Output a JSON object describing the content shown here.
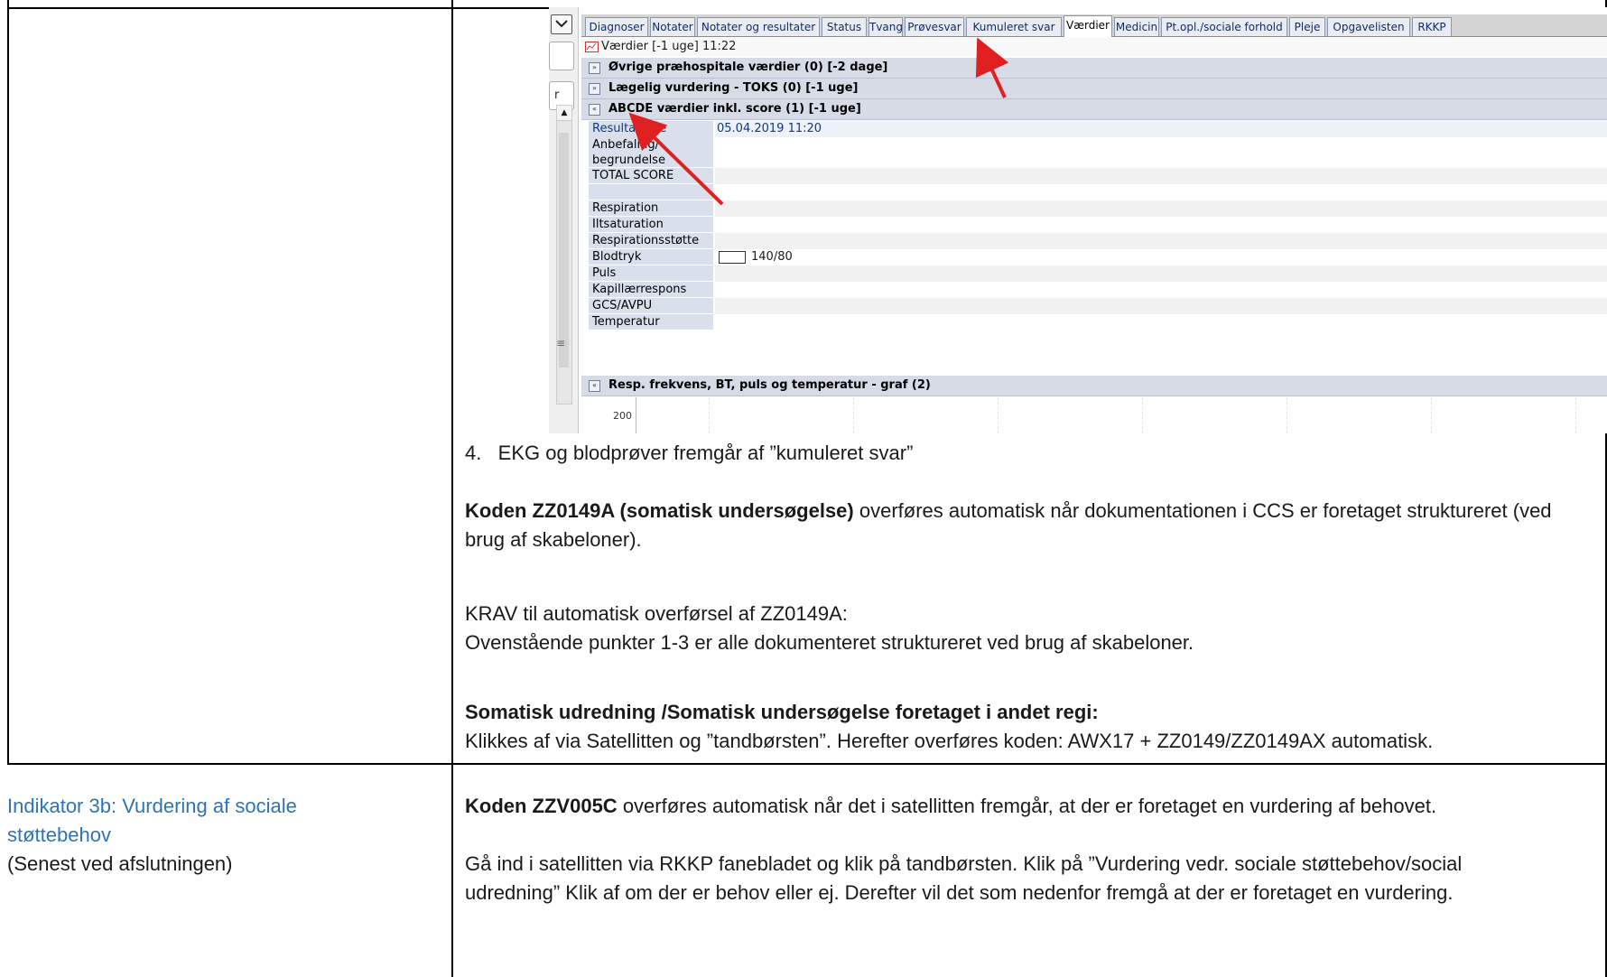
{
  "screenshot": {
    "tabs": [
      "Diagnoser",
      "Notater",
      "Notater og resultater",
      "Status",
      "Tvang",
      "Prøvesvar",
      "Kumuleret svar",
      "Værdier",
      "Medicin",
      "Pt.opl./sociale forhold",
      "Pleje",
      "Opgavelisten",
      "RKKP"
    ],
    "active_tab": "Værdier",
    "title": "Værdier [-1 uge] 11:22",
    "sections": [
      {
        "label": "Øvrige præhospitale værdier (0)  [-2 dage]"
      },
      {
        "label": "Lægelig vurdering - TOKS (0)  [-1 uge]"
      },
      {
        "label": "ABCDE værdier inkl. score (1)  [-1 uge]"
      }
    ],
    "grid_header": {
      "label": "Resultattype",
      "date": "05.04.2019 11:20"
    },
    "grid_rows": [
      {
        "label": "Anbefaling/ begrundelse",
        "value": ""
      },
      {
        "label": "TOTAL SCORE",
        "value": ""
      },
      {
        "label": "",
        "value": ""
      },
      {
        "label": "Respiration",
        "value": ""
      },
      {
        "label": "Iltsaturation",
        "value": ""
      },
      {
        "label": "Respirationsstøtte",
        "value": ""
      },
      {
        "label": "Blodtryk",
        "value": "140/80"
      },
      {
        "label": "Puls",
        "value": ""
      },
      {
        "label": "Kapillærrespons",
        "value": ""
      },
      {
        "label": "GCS/AVPU",
        "value": ""
      },
      {
        "label": "Temperatur",
        "value": ""
      }
    ],
    "graph_section": "Resp. frekvens, BT, puls og temperatur - graf (2)",
    "graph_tick": "200",
    "sidebar_letter": "r"
  },
  "doc": {
    "step4": "4.   EKG og blodprøver fremgår af ”kumuleret svar”",
    "p1_bold": "Koden ZZ0149A (somatisk undersøgelse)",
    "p1_rest": " overføres automatisk når dokumentationen i CCS er foretaget struktureret (ved brug af skabeloner).",
    "krav_line1": "KRAV til automatisk overførsel af ZZ0149A:",
    "krav_line2": "Ovenstående punkter 1-3 er alle dokumenteret struktureret ved brug af skabeloner.",
    "somatisk_heading": "Somatisk udredning /Somatisk undersøgelse foretaget i andet regi:",
    "somatisk_text": "Klikkes af via Satellitten og ”tandbørsten”. Herefter overføres koden: AWX17 + ZZ0149/ZZ0149AX automatisk.",
    "indikator_title": "Indikator 3b: Vurdering af sociale støttebehov",
    "indikator_sub": "(Senest ved afslutningen)",
    "p2_bold": "Koden ZZV005C",
    "p2_rest": " overføres automatisk når det i satellitten fremgår, at der er foretaget en vurdering af behovet.",
    "p3": "Gå ind i satellitten via RKKP fanebladet og klik på tandbørsten. Klik på ”Vurdering vedr. sociale støttebehov/social udredning” Klik af om der er behov eller ej. Derefter vil det som nedenfor fremgå at der er foretaget en vurdering."
  },
  "colors": {
    "indicator_text": "#2e74b5",
    "arrow": "#e02020",
    "section_bg": "#d6dbe6",
    "grid_label_bg": "#d9e0ec"
  }
}
